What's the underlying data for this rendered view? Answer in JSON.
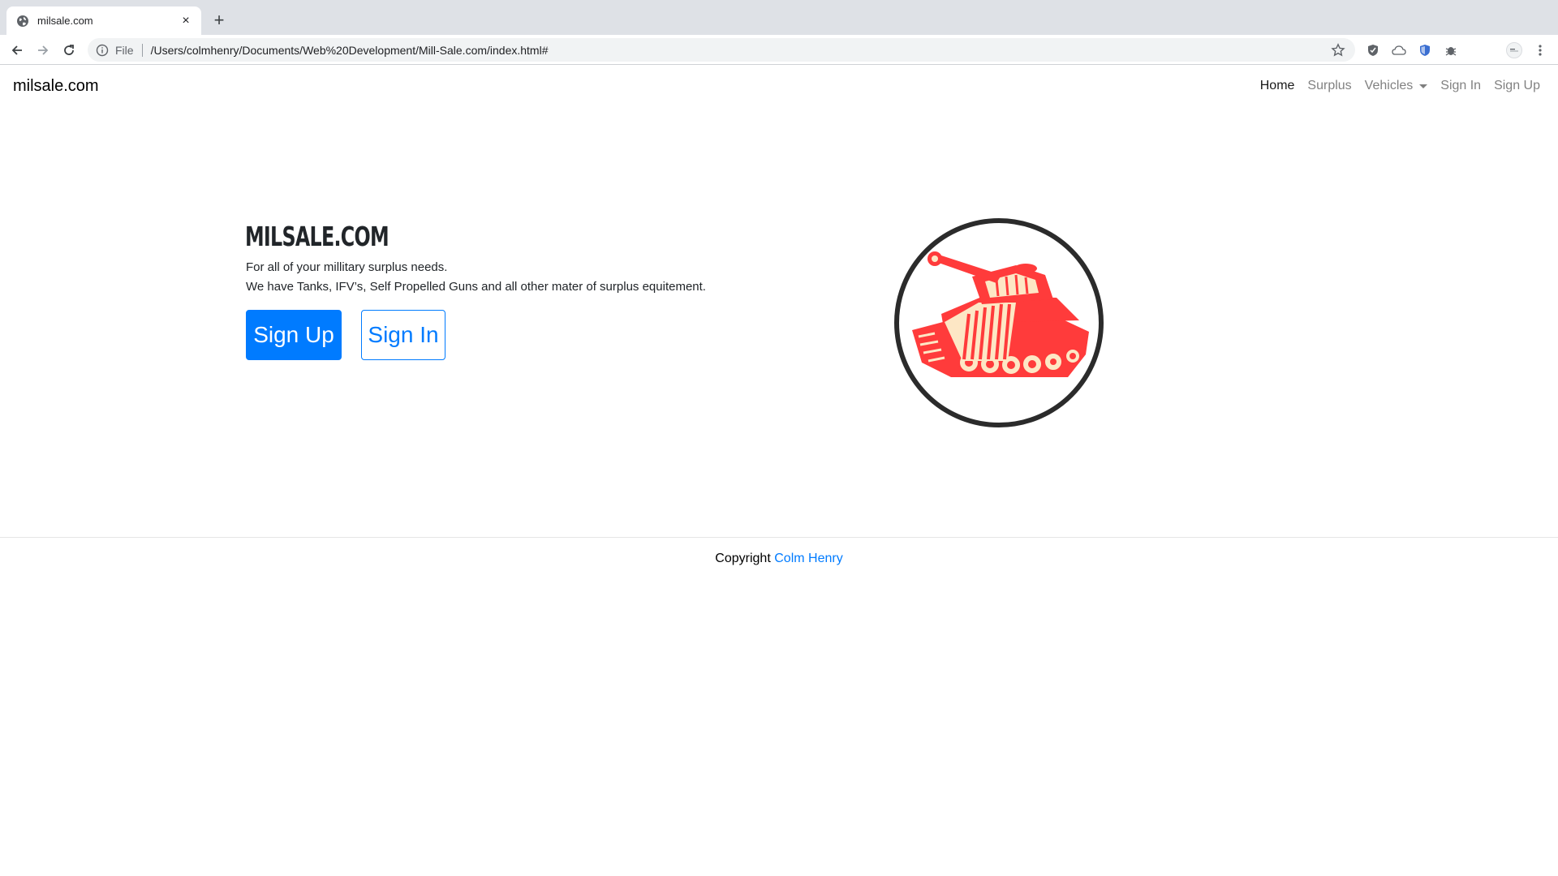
{
  "browser": {
    "tab_title": "milsale.com",
    "tab_close": "×",
    "new_tab": "+",
    "scheme_label": "File",
    "url": "/Users/colmhenry/Documents/Web%20Development/Mill-Sale.com/index.html#"
  },
  "site": {
    "brand": "milsale.com",
    "nav": {
      "home": "Home",
      "surplus": "Surplus",
      "vehicles": "Vehicles",
      "sign_in": "Sign In",
      "sign_up": "Sign Up"
    },
    "hero": {
      "title": "MILSALE.COM",
      "line1": "For all of your millitary surplus needs.",
      "line2": "We have Tanks, IFV’s, Self Propelled Guns and all other mater of surplus equitement.",
      "signup_button": "Sign Up",
      "signin_button": "Sign In"
    },
    "footer": {
      "prefix": "Copyright",
      "author": "Colm Henry"
    }
  },
  "colors": {
    "primary": "#007bff",
    "tank_red": "#ff3b3b",
    "tank_cream": "#fde7c5",
    "logo_ring": "#2b2b2b"
  },
  "icons": {
    "favicon": "globe-icon",
    "logo": "tank-icon"
  }
}
